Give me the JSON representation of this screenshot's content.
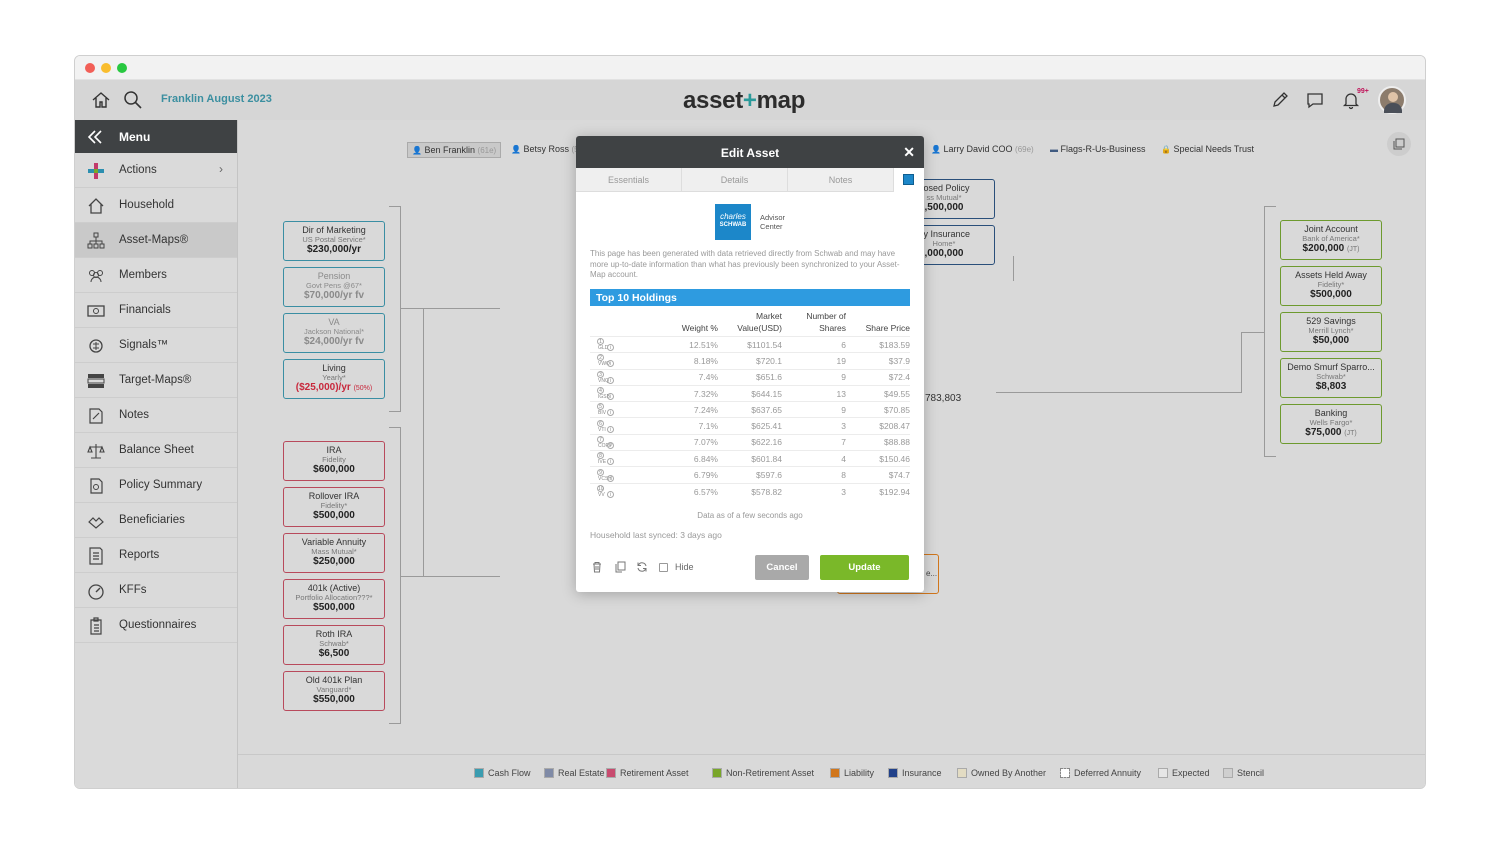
{
  "household": "Franklin August 2023",
  "brand": {
    "left": "asset",
    "plus": "+",
    "right": "map"
  },
  "notifications_badge": "99+",
  "menu": {
    "title": "Menu",
    "items": [
      {
        "label": "Actions",
        "icon": "plus-icon"
      },
      {
        "label": "Household",
        "icon": "house-icon"
      },
      {
        "label": "Asset-Maps®",
        "icon": "sitemap-icon"
      },
      {
        "label": "Members",
        "icon": "members-icon"
      },
      {
        "label": "Financials",
        "icon": "money-icon"
      },
      {
        "label": "Signals™",
        "icon": "signal-icon"
      },
      {
        "label": "Target-Maps®",
        "icon": "target-icon"
      },
      {
        "label": "Notes",
        "icon": "notes-icon"
      },
      {
        "label": "Balance Sheet",
        "icon": "scale-icon"
      },
      {
        "label": "Policy Summary",
        "icon": "policy-icon"
      },
      {
        "label": "Beneficiaries",
        "icon": "hands-icon"
      },
      {
        "label": "Reports",
        "icon": "report-icon"
      },
      {
        "label": "KFFs",
        "icon": "gauge-icon"
      },
      {
        "label": "Questionnaires",
        "icon": "clipboard-icon"
      }
    ]
  },
  "members": [
    {
      "name": "Ben Franklin",
      "age": "(61e)"
    },
    {
      "name": "Betsy Ross",
      "age": "(5"
    },
    {
      "name": "Larry David COO",
      "age": "(69e)"
    },
    {
      "name": "Flags-R-Us-Business",
      "age": ""
    },
    {
      "name": "Special Needs Trust",
      "age": ""
    }
  ],
  "cashflow": [
    {
      "name": "Dir of Marketing",
      "sub": "US Postal Service*",
      "value": "$230,000/yr"
    },
    {
      "name": "Pension",
      "sub": "Govt Pens @67*",
      "value": "$70,000/yr fv"
    },
    {
      "name": "VA",
      "sub": "Jackson National*",
      "value": "$24,000/yr fv"
    },
    {
      "name": "Living",
      "sub": "Yearly*",
      "value": "($25,000)/yr",
      "extra": "(50%)"
    }
  ],
  "retirement": [
    {
      "name": "IRA",
      "sub": "Fidelity",
      "value": "$600,000"
    },
    {
      "name": "Rollover IRA",
      "sub": "Fidelity*",
      "value": "$500,000"
    },
    {
      "name": "Variable Annuity",
      "sub": "Mass Mutual*",
      "value": "$250,000"
    },
    {
      "name": "401k (Active)",
      "sub": "Portfolio Allocation???*",
      "value": "$500,000"
    },
    {
      "name": "Roth IRA",
      "sub": "Schwab*",
      "value": "$6,500"
    },
    {
      "name": "Old 401k Plan",
      "sub": "Vanguard*",
      "value": "$550,000"
    }
  ],
  "nonretirement": [
    {
      "name": "Joint Account",
      "sub": "Bank of America*",
      "value": "$200,000",
      "tag": "(JT)"
    },
    {
      "name": "Assets Held Away",
      "sub": "Fidelity*",
      "value": "$500,000",
      "tag": ""
    },
    {
      "name": "529 Savings",
      "sub": "Merrill Lynch*",
      "value": "$50,000",
      "tag": ""
    },
    {
      "name": "Demo Smurf Sparro...",
      "sub": "Schwab*",
      "value": "$8,803",
      "tag": ""
    },
    {
      "name": "Banking",
      "sub": "Wells Fargo*",
      "value": "$75,000",
      "tag": "(JT)"
    }
  ],
  "insurance": [
    {
      "name": "posed Policy",
      "sub": "ss Mutual*",
      "value": ",500,000"
    },
    {
      "name": "rty Insurance",
      "sub": "Home*",
      "value": ",000,000"
    }
  ],
  "center_total": "783,803",
  "partial_box": "e...",
  "legend": [
    {
      "label": "Cash Flow",
      "color": "#3a9cb0"
    },
    {
      "label": "Real Estate",
      "color": "#7f8aa6"
    },
    {
      "label": "Retirement Asset",
      "color": "#c84b6f"
    },
    {
      "label": "Non-Retirement Asset",
      "color": "#79a62a"
    },
    {
      "label": "Liability",
      "color": "#d0761c"
    },
    {
      "label": "Insurance",
      "color": "#21418a"
    },
    {
      "label": "Owned By Another",
      "color": "#e3dcc3"
    },
    {
      "label": "Deferred Annuity",
      "color": "#ffffff"
    },
    {
      "label": "Expected",
      "color": "#e6e6e6"
    },
    {
      "label": "Stencil",
      "color": "#cfcfcf"
    }
  ],
  "modal": {
    "title": "Edit Asset",
    "tabs": [
      "Essentials",
      "Details",
      "Notes"
    ],
    "logo": {
      "line1": "charles",
      "line2": "SCHWAB",
      "advisor": "Advisor",
      "center": "Center"
    },
    "notice": "This page has been generated with data retrieved directly from Schwab and may have more up-to-date information than what has previously been synchronized to your Asset-Map account.",
    "table_title": "Top 10 Holdings",
    "columns": [
      "",
      "Weight %",
      "Market Value(USD)",
      "Number of Shares",
      "Share Price"
    ],
    "rows": [
      [
        "1 GLD",
        "12.51%",
        "$1101.54",
        "6",
        "$183.59"
      ],
      [
        "2 VWO",
        "8.18%",
        "$720.1",
        "19",
        "$37.9"
      ],
      [
        "3 VNQ",
        "7.4%",
        "$651.6",
        "9",
        "$72.4"
      ],
      [
        "4 IGSB",
        "7.32%",
        "$644.15",
        "13",
        "$49.55"
      ],
      [
        "5 BIV",
        "7.24%",
        "$637.65",
        "9",
        "$70.85"
      ],
      [
        "6 VTI",
        "7.1%",
        "$625.41",
        "3",
        "$208.47"
      ],
      [
        "7 CORP",
        "7.07%",
        "$622.16",
        "7",
        "$88.88"
      ],
      [
        "8 IVE",
        "6.84%",
        "$601.84",
        "4",
        "$150.46"
      ],
      [
        "9 VCSH",
        "6.79%",
        "$597.6",
        "8",
        "$74.7"
      ],
      [
        "10 VV",
        "6.57%",
        "$578.82",
        "3",
        "$192.94"
      ]
    ],
    "as_of": "Data as of a few seconds ago",
    "synced": "Household last synced: 3 days ago",
    "hide_label": "Hide",
    "cancel": "Cancel",
    "update": "Update",
    "cancel_color": "#a9a9a9",
    "update_color": "#7ab829"
  }
}
